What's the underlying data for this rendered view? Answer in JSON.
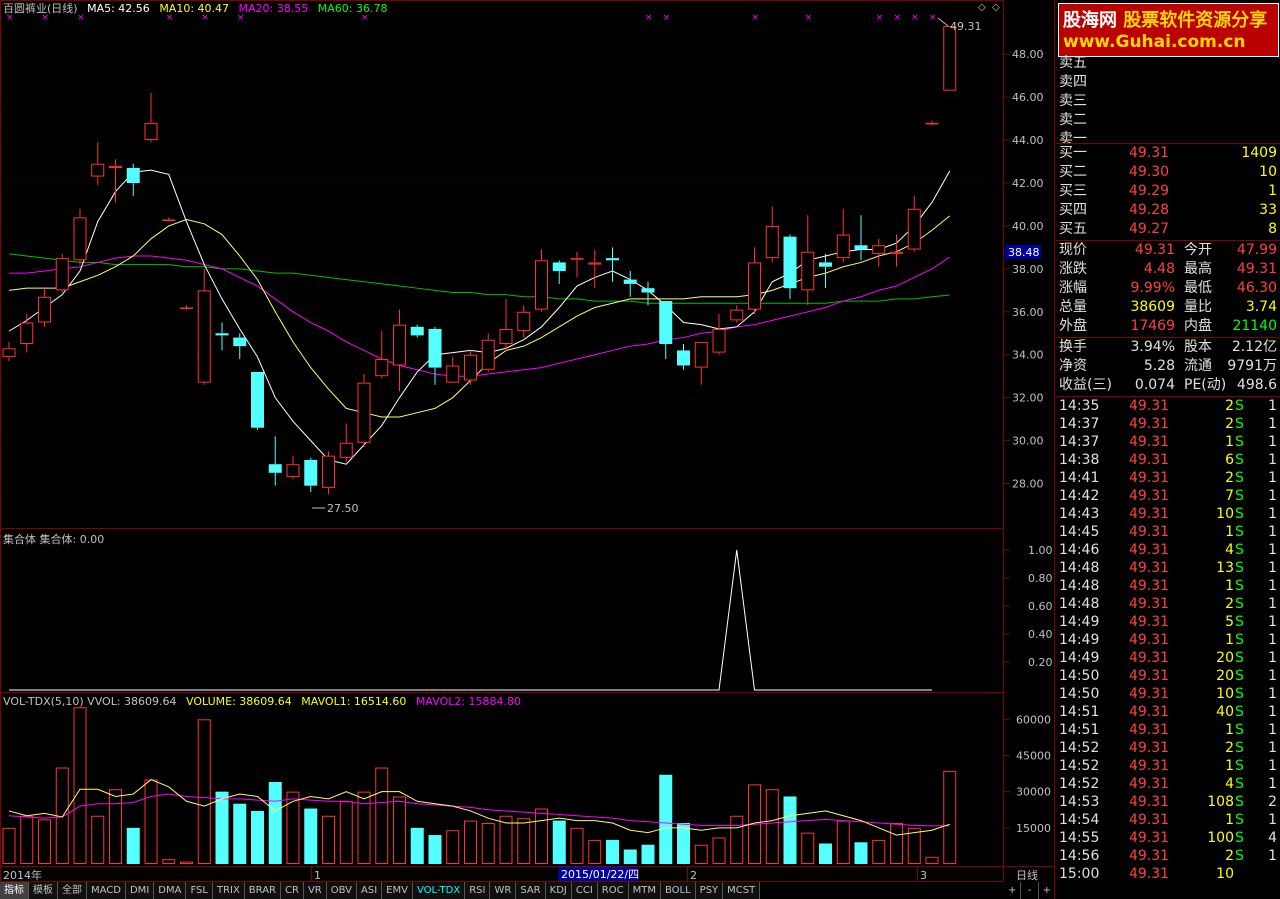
{
  "price_legend": {
    "title": "百圆裤业(日线)",
    "ma5": "MA5: 42.56",
    "ma10": "MA10: 40.47",
    "ma20": "MA20: 38.55",
    "ma60": "MA60: 36.78"
  },
  "price_axis": [
    "48.00",
    "46.00",
    "44.00",
    "42.00",
    "40.00",
    "38.00",
    "36.00",
    "34.00",
    "32.00",
    "30.00",
    "28.00"
  ],
  "price_tag": "38.48",
  "high_label": "49.31",
  "low_label": "27.50",
  "indicator_legend": "集合体  集合体: 0.00",
  "indicator_axis": [
    "1.00",
    "0.80",
    "0.60",
    "0.40",
    "0.20"
  ],
  "vol_legend": {
    "title": "VOL-TDX(5,10)  VVOL: 38609.64",
    "volume": "VOLUME: 38609.64",
    "mavol1": "MAVOL1: 16514.60",
    "mavol2": "MAVOL2: 15884.80"
  },
  "vol_axis": [
    "60000",
    "45000",
    "30000",
    "15000"
  ],
  "date_axis": {
    "start": "2014年",
    "m1": "1",
    "cursor": "2015/01/22/四",
    "m2": "2",
    "m3": "3",
    "period": "日线"
  },
  "tabs": [
    "指标",
    "模板",
    "全部",
    "MACD",
    "DMI",
    "DMA",
    "FSL",
    "TRIX",
    "BRAR",
    "CR",
    "VR",
    "OBV",
    "ASI",
    "EMV",
    "VOL-TDX",
    "RSI",
    "WR",
    "SAR",
    "KDJ",
    "CCI",
    "ROC",
    "MTM",
    "BOLL",
    "PSY",
    "MCST"
  ],
  "active_tab": "VOL-TDX",
  "tab_controls": [
    "+",
    "-",
    "+"
  ],
  "logo": {
    "line1_a": "股海网",
    "line1_b": " 股票软件资源分享",
    "line2": "www.Guhai.com.cn"
  },
  "asks": [
    "卖五",
    "卖四",
    "卖三",
    "卖二",
    "卖一"
  ],
  "bids": [
    {
      "label": "买一",
      "price": "49.31",
      "vol": "1409"
    },
    {
      "label": "买二",
      "price": "49.30",
      "vol": "10"
    },
    {
      "label": "买三",
      "price": "49.29",
      "vol": "1"
    },
    {
      "label": "买四",
      "price": "49.28",
      "vol": "33"
    },
    {
      "label": "买五",
      "price": "49.27",
      "vol": "8"
    }
  ],
  "quote": [
    {
      "l1": "现价",
      "v1": "49.31",
      "l2": "今开",
      "v2": "47.99"
    },
    {
      "l1": "涨跌",
      "v1": "4.48",
      "l2": "最高",
      "v2": "49.31"
    },
    {
      "l1": "涨幅",
      "v1": "9.99%",
      "l2": "最低",
      "v2": "46.30"
    },
    {
      "l1": "总量",
      "v1": "38609",
      "l2": "量比",
      "v2": "3.74"
    },
    {
      "l1": "外盘",
      "v1": "17469",
      "l2": "内盘",
      "v2": "21140"
    }
  ],
  "fundamentals": [
    {
      "l1": "换手",
      "v1": "3.94%",
      "l2": "股本",
      "v2": "2.12亿"
    },
    {
      "l1": "净资",
      "v1": "5.28",
      "l2": "流通",
      "v2": "9791万"
    },
    {
      "l1": "收益(三)",
      "v1": "0.074",
      "l2": "PE(动)",
      "v2": "498.6"
    }
  ],
  "ticks": [
    [
      "14:35",
      "49.31",
      "2",
      "S",
      "1"
    ],
    [
      "14:37",
      "49.31",
      "2",
      "S",
      "1"
    ],
    [
      "14:37",
      "49.31",
      "1",
      "S",
      "1"
    ],
    [
      "14:38",
      "49.31",
      "6",
      "S",
      "1"
    ],
    [
      "14:41",
      "49.31",
      "2",
      "S",
      "1"
    ],
    [
      "14:42",
      "49.31",
      "7",
      "S",
      "1"
    ],
    [
      "14:43",
      "49.31",
      "10",
      "S",
      "1"
    ],
    [
      "14:45",
      "49.31",
      "1",
      "S",
      "1"
    ],
    [
      "14:46",
      "49.31",
      "4",
      "S",
      "1"
    ],
    [
      "14:48",
      "49.31",
      "13",
      "S",
      "1"
    ],
    [
      "14:48",
      "49.31",
      "1",
      "S",
      "1"
    ],
    [
      "14:48",
      "49.31",
      "2",
      "S",
      "1"
    ],
    [
      "14:49",
      "49.31",
      "5",
      "S",
      "1"
    ],
    [
      "14:49",
      "49.31",
      "1",
      "S",
      "1"
    ],
    [
      "14:49",
      "49.31",
      "20",
      "S",
      "1"
    ],
    [
      "14:50",
      "49.31",
      "20",
      "S",
      "1"
    ],
    [
      "14:50",
      "49.31",
      "10",
      "S",
      "1"
    ],
    [
      "14:51",
      "49.31",
      "40",
      "S",
      "1"
    ],
    [
      "14:51",
      "49.31",
      "1",
      "S",
      "1"
    ],
    [
      "14:52",
      "49.31",
      "2",
      "S",
      "1"
    ],
    [
      "14:52",
      "49.31",
      "1",
      "S",
      "1"
    ],
    [
      "14:52",
      "49.31",
      "4",
      "S",
      "1"
    ],
    [
      "14:53",
      "49.31",
      "108",
      "S",
      "2"
    ],
    [
      "14:54",
      "49.31",
      "1",
      "S",
      "1"
    ],
    [
      "14:55",
      "49.31",
      "100",
      "S",
      "4"
    ],
    [
      "14:56",
      "49.31",
      "2",
      "S",
      "1"
    ],
    [
      "15:00",
      "49.31",
      "10",
      "",
      ""
    ]
  ],
  "chart_data": {
    "type": "candlestick",
    "title": "百圆裤业(日线)",
    "ylim": [
      27,
      49.5
    ],
    "candles": [
      {
        "o": 33.9,
        "c": 34.3,
        "h": 34.6,
        "l": 33.7
      },
      {
        "o": 34.5,
        "c": 35.5,
        "h": 35.9,
        "l": 34.1
      },
      {
        "o": 35.5,
        "c": 36.7,
        "h": 37.1,
        "l": 35.3
      },
      {
        "o": 37.0,
        "c": 38.5,
        "h": 38.7,
        "l": 36.9
      },
      {
        "o": 38.4,
        "c": 40.4,
        "h": 40.8,
        "l": 38.2
      },
      {
        "o": 42.3,
        "c": 42.9,
        "h": 43.9,
        "l": 41.9
      },
      {
        "o": 42.7,
        "c": 42.8,
        "h": 43.1,
        "l": 41.1
      },
      {
        "o": 42.7,
        "c": 42.0,
        "h": 42.9,
        "l": 41.4
      },
      {
        "o": 44.0,
        "c": 44.8,
        "h": 46.2,
        "l": 43.9
      },
      {
        "o": 40.3,
        "c": 40.3,
        "h": 40.4,
        "l": 40.2
      },
      {
        "o": 36.2,
        "c": 36.2,
        "h": 36.3,
        "l": 36.1
      },
      {
        "o": 32.7,
        "c": 37.0,
        "h": 38.0,
        "l": 32.6
      },
      {
        "o": 35.0,
        "c": 34.9,
        "h": 35.5,
        "l": 34.2
      },
      {
        "o": 34.8,
        "c": 34.4,
        "h": 35.0,
        "l": 33.8
      },
      {
        "o": 33.2,
        "c": 30.6,
        "h": 33.2,
        "l": 30.5
      },
      {
        "o": 28.9,
        "c": 28.5,
        "h": 30.2,
        "l": 27.9
      },
      {
        "o": 28.3,
        "c": 28.9,
        "h": 29.3,
        "l": 28.2
      },
      {
        "o": 29.1,
        "c": 27.9,
        "h": 29.2,
        "l": 27.6
      },
      {
        "o": 27.8,
        "c": 29.3,
        "h": 29.5,
        "l": 27.5
      },
      {
        "o": 29.2,
        "c": 29.9,
        "h": 30.8,
        "l": 29.0
      },
      {
        "o": 29.9,
        "c": 32.7,
        "h": 33.1,
        "l": 29.7
      },
      {
        "o": 33.0,
        "c": 33.8,
        "h": 35.1,
        "l": 32.9
      },
      {
        "o": 33.5,
        "c": 35.4,
        "h": 36.1,
        "l": 32.3
      },
      {
        "o": 35.3,
        "c": 34.9,
        "h": 35.4,
        "l": 34.8
      },
      {
        "o": 35.2,
        "c": 33.4,
        "h": 35.3,
        "l": 32.6
      },
      {
        "o": 32.7,
        "c": 33.5,
        "h": 33.9,
        "l": 32.7
      },
      {
        "o": 32.8,
        "c": 34.0,
        "h": 34.2,
        "l": 32.6
      },
      {
        "o": 33.3,
        "c": 34.7,
        "h": 35.0,
        "l": 33.2
      },
      {
        "o": 34.5,
        "c": 35.2,
        "h": 36.6,
        "l": 34.2
      },
      {
        "o": 35.1,
        "c": 36.0,
        "h": 36.3,
        "l": 34.8
      },
      {
        "o": 36.1,
        "c": 38.4,
        "h": 38.9,
        "l": 36.0
      },
      {
        "o": 38.3,
        "c": 37.9,
        "h": 38.4,
        "l": 37.3
      },
      {
        "o": 38.5,
        "c": 38.5,
        "h": 38.8,
        "l": 37.6
      },
      {
        "o": 38.2,
        "c": 38.3,
        "h": 38.9,
        "l": 37.1
      },
      {
        "o": 38.5,
        "c": 38.4,
        "h": 39.0,
        "l": 37.4
      },
      {
        "o": 37.5,
        "c": 37.3,
        "h": 37.9,
        "l": 36.7
      },
      {
        "o": 37.1,
        "c": 36.9,
        "h": 37.4,
        "l": 36.3
      },
      {
        "o": 36.5,
        "c": 34.5,
        "h": 36.5,
        "l": 33.8
      },
      {
        "o": 34.2,
        "c": 33.5,
        "h": 34.5,
        "l": 33.3
      },
      {
        "o": 33.4,
        "c": 34.6,
        "h": 34.6,
        "l": 32.6
      },
      {
        "o": 34.1,
        "c": 35.2,
        "h": 35.9,
        "l": 34.0
      },
      {
        "o": 35.6,
        "c": 36.1,
        "h": 36.3,
        "l": 35.5
      },
      {
        "o": 36.1,
        "c": 38.3,
        "h": 39.0,
        "l": 35.9
      },
      {
        "o": 38.5,
        "c": 40.0,
        "h": 40.9,
        "l": 38.3
      },
      {
        "o": 39.5,
        "c": 37.1,
        "h": 39.6,
        "l": 36.6
      },
      {
        "o": 37.0,
        "c": 38.8,
        "h": 40.5,
        "l": 36.3
      },
      {
        "o": 38.3,
        "c": 38.1,
        "h": 38.7,
        "l": 37.1
      },
      {
        "o": 38.5,
        "c": 39.6,
        "h": 40.8,
        "l": 38.3
      },
      {
        "o": 39.1,
        "c": 38.9,
        "h": 40.5,
        "l": 38.4
      },
      {
        "o": 38.7,
        "c": 39.1,
        "h": 39.4,
        "l": 38.1
      },
      {
        "o": 38.7,
        "c": 38.8,
        "h": 39.6,
        "l": 38.1
      },
      {
        "o": 38.9,
        "c": 40.8,
        "h": 41.4,
        "l": 38.8
      },
      {
        "o": 44.8,
        "c": 44.8,
        "h": 44.9,
        "l": 44.7
      },
      {
        "o": 46.3,
        "c": 49.31,
        "h": 49.31,
        "l": 46.3
      }
    ],
    "ma5": [
      35.1,
      35.6,
      36.2,
      36.8,
      37.9,
      40.2,
      41.6,
      42.5,
      42.6,
      42.4,
      40.2,
      38.2,
      36.6,
      35.2,
      33.9,
      32.0,
      30.9,
      30.0,
      29.1,
      28.9,
      29.8,
      30.7,
      32.0,
      33.2,
      34.0,
      34.1,
      34.2,
      34.1,
      34.3,
      34.7,
      35.3,
      36.2,
      37.2,
      37.6,
      37.9,
      37.5,
      37.0,
      36.3,
      35.5,
      35.4,
      35.2,
      35.3,
      36.0,
      37.4,
      37.8,
      38.4,
      38.6,
      38.8,
      38.9,
      38.9,
      39.2,
      40.0,
      41.1,
      42.56
    ],
    "ma10": [
      37.0,
      37.1,
      37.1,
      37.1,
      37.4,
      37.7,
      38.1,
      38.6,
      39.4,
      40.0,
      40.3,
      40.1,
      39.6,
      38.6,
      37.5,
      36.0,
      34.6,
      33.4,
      32.4,
      31.5,
      31.3,
      31.1,
      31.1,
      31.3,
      31.5,
      32.0,
      32.8,
      33.6,
      34.2,
      34.4,
      34.8,
      35.3,
      35.8,
      36.2,
      36.4,
      36.6,
      36.6,
      36.6,
      36.6,
      36.7,
      36.7,
      36.7,
      36.8,
      37.0,
      37.3,
      37.6,
      37.8,
      38.1,
      38.3,
      38.6,
      38.8,
      39.2,
      39.8,
      40.47
    ],
    "ma20": [
      37.8,
      37.8,
      37.9,
      38.0,
      38.1,
      38.3,
      38.5,
      38.6,
      38.6,
      38.5,
      38.4,
      38.2,
      38.0,
      37.6,
      37.2,
      36.6,
      36.0,
      35.5,
      35.1,
      34.6,
      34.2,
      33.8,
      33.5,
      33.3,
      33.1,
      33.0,
      33.0,
      33.1,
      33.2,
      33.3,
      33.4,
      33.6,
      33.8,
      34.0,
      34.2,
      34.4,
      34.5,
      34.7,
      34.8,
      35.0,
      35.1,
      35.3,
      35.4,
      35.6,
      35.8,
      36.0,
      36.2,
      36.5,
      36.7,
      37.0,
      37.2,
      37.6,
      38.0,
      38.55
    ],
    "ma60": [
      38.7,
      38.6,
      38.5,
      38.4,
      38.3,
      38.3,
      38.2,
      38.2,
      38.2,
      38.2,
      38.1,
      38.1,
      38.0,
      38.0,
      37.9,
      37.8,
      37.8,
      37.7,
      37.6,
      37.5,
      37.4,
      37.3,
      37.2,
      37.1,
      37.0,
      36.9,
      36.9,
      36.8,
      36.8,
      36.7,
      36.7,
      36.6,
      36.6,
      36.5,
      36.5,
      36.5,
      36.4,
      36.4,
      36.4,
      36.4,
      36.4,
      36.4,
      36.4,
      36.4,
      36.4,
      36.4,
      36.4,
      36.5,
      36.5,
      36.5,
      36.6,
      36.6,
      36.7,
      36.78
    ],
    "indicator": {
      "name": "集合体",
      "ylim": [
        0,
        1.1
      ],
      "values": [
        0,
        0,
        0,
        0,
        0,
        0,
        0,
        0,
        0,
        0,
        0,
        0,
        0,
        0,
        0,
        0,
        0,
        0,
        0,
        0,
        0,
        0,
        0,
        0,
        0,
        0,
        0,
        0,
        0,
        0,
        0,
        0,
        0,
        0,
        0,
        0,
        0,
        0,
        0,
        0,
        0,
        1.0,
        0,
        0,
        0,
        0,
        0,
        0,
        0,
        0,
        0,
        0,
        0
      ]
    },
    "volume": {
      "ylim": [
        0,
        68000
      ],
      "values": [
        15000,
        20000,
        18500,
        40000,
        65000,
        20000,
        31000,
        15000,
        35000,
        2000,
        1000,
        60000,
        30000,
        25000,
        22000,
        34000,
        30000,
        23000,
        20000,
        26000,
        30000,
        40000,
        28000,
        15000,
        12000,
        14000,
        18000,
        17000,
        20000,
        19000,
        23000,
        18000,
        15000,
        10000,
        10000,
        6000,
        8000,
        37000,
        17000,
        8000,
        11000,
        20000,
        33000,
        31000,
        28000,
        13000,
        8500,
        18000,
        9000,
        10000,
        17000,
        15000,
        3000,
        38609
      ],
      "mavol1": [
        22000,
        20000,
        21000,
        19500,
        31000,
        31000,
        28000,
        29000,
        35000,
        32000,
        26000,
        24000,
        27000,
        29000,
        28000,
        22000,
        26000,
        28000,
        27000,
        30000,
        27000,
        30000,
        30000,
        26000,
        25000,
        24000,
        22000,
        19000,
        17000,
        17000,
        18000,
        19000,
        18000,
        18000,
        17000,
        14000,
        13000,
        15000,
        15000,
        14000,
        15000,
        15000,
        17000,
        18000,
        20000,
        21000,
        22000,
        20000,
        18000,
        15000,
        12000,
        13000,
        14000,
        16514.6
      ],
      "mavol2": [
        20000,
        19500,
        19000,
        19500,
        24000,
        25000,
        25000,
        25500,
        28000,
        29000,
        28000,
        27500,
        27000,
        27000,
        26500,
        26000,
        27000,
        26500,
        26000,
        26000,
        25000,
        25500,
        26000,
        25000,
        24500,
        24000,
        23500,
        22500,
        22000,
        21500,
        21000,
        20500,
        20000,
        19500,
        19000,
        18000,
        17500,
        17000,
        16500,
        16000,
        16000,
        16000,
        16500,
        17000,
        17500,
        18000,
        18500,
        18000,
        17500,
        17000,
        16500,
        16000,
        15800,
        15884.8
      ]
    }
  }
}
